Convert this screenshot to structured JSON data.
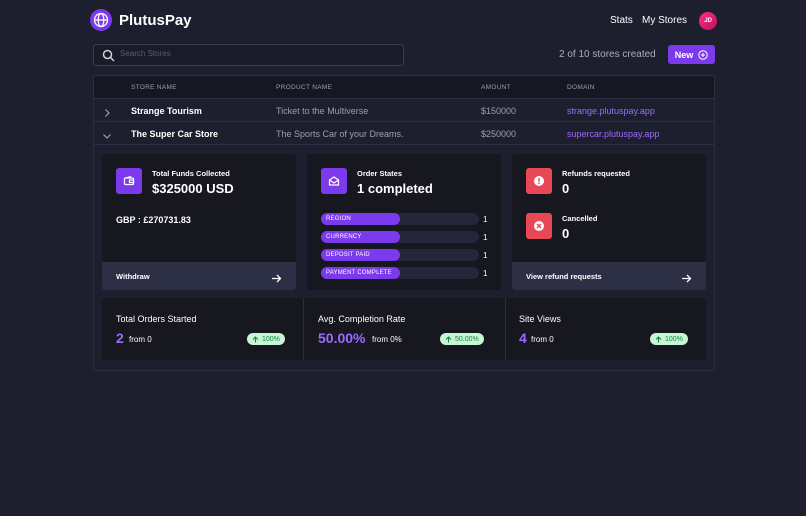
{
  "header": {
    "brand": "PlutusPay",
    "nav": {
      "stats": "Stats",
      "my_stores": "My Stores"
    },
    "avatar_initials": "JD"
  },
  "toolbar": {
    "search_placeholder": "Search Stores",
    "stores_count": "2 of 10 stores created",
    "new_label": "New"
  },
  "table": {
    "columns": [
      "STORE NAME",
      "PRODUCT NAME",
      "AMOUNT",
      "DOMAIN"
    ],
    "rows": [
      {
        "store": "Strange Tourism",
        "product": "Ticket to the Multiverse",
        "amount": "$150000",
        "domain": "strange.plutuspay.app",
        "expanded": false
      },
      {
        "store": "The Super Car Store",
        "product": "The Sports Car of your Dreams.",
        "amount": "$250000",
        "domain": "supercar.plutuspay.app",
        "expanded": true
      }
    ]
  },
  "details": {
    "funds": {
      "label": "Total Funds Collected",
      "value": "$325000 USD",
      "gbp": "GBP : £270731.83",
      "action": "Withdraw"
    },
    "orders": {
      "label": "Order States",
      "value": "1 completed",
      "states": [
        {
          "name": "REGION",
          "count": "1",
          "fill": 0.5
        },
        {
          "name": "CURRENCY",
          "count": "1",
          "fill": 0.5
        },
        {
          "name": "DEPOSIT PAID",
          "count": "1",
          "fill": 0.5
        },
        {
          "name": "PAYMENT COMPLETE",
          "count": "1",
          "fill": 0.5
        }
      ]
    },
    "refunds": {
      "requested_label": "Refunds requested",
      "requested_value": "0",
      "cancelled_label": "Cancelled",
      "cancelled_value": "0",
      "action": "View refund requests"
    }
  },
  "stats": [
    {
      "title": "Total Orders Started",
      "value": "2",
      "from": "from 0",
      "change": "100%"
    },
    {
      "title": "Avg. Completion Rate",
      "value": "50.00%",
      "from": "from 0%",
      "change": "50.00%"
    },
    {
      "title": "Site Views",
      "value": "4",
      "from": "from 0",
      "change": "100%"
    }
  ],
  "colors": {
    "accent": "#7c3aed",
    "danger": "#e84855",
    "link": "#9b6bff",
    "success_bg": "#c8f5d6"
  }
}
